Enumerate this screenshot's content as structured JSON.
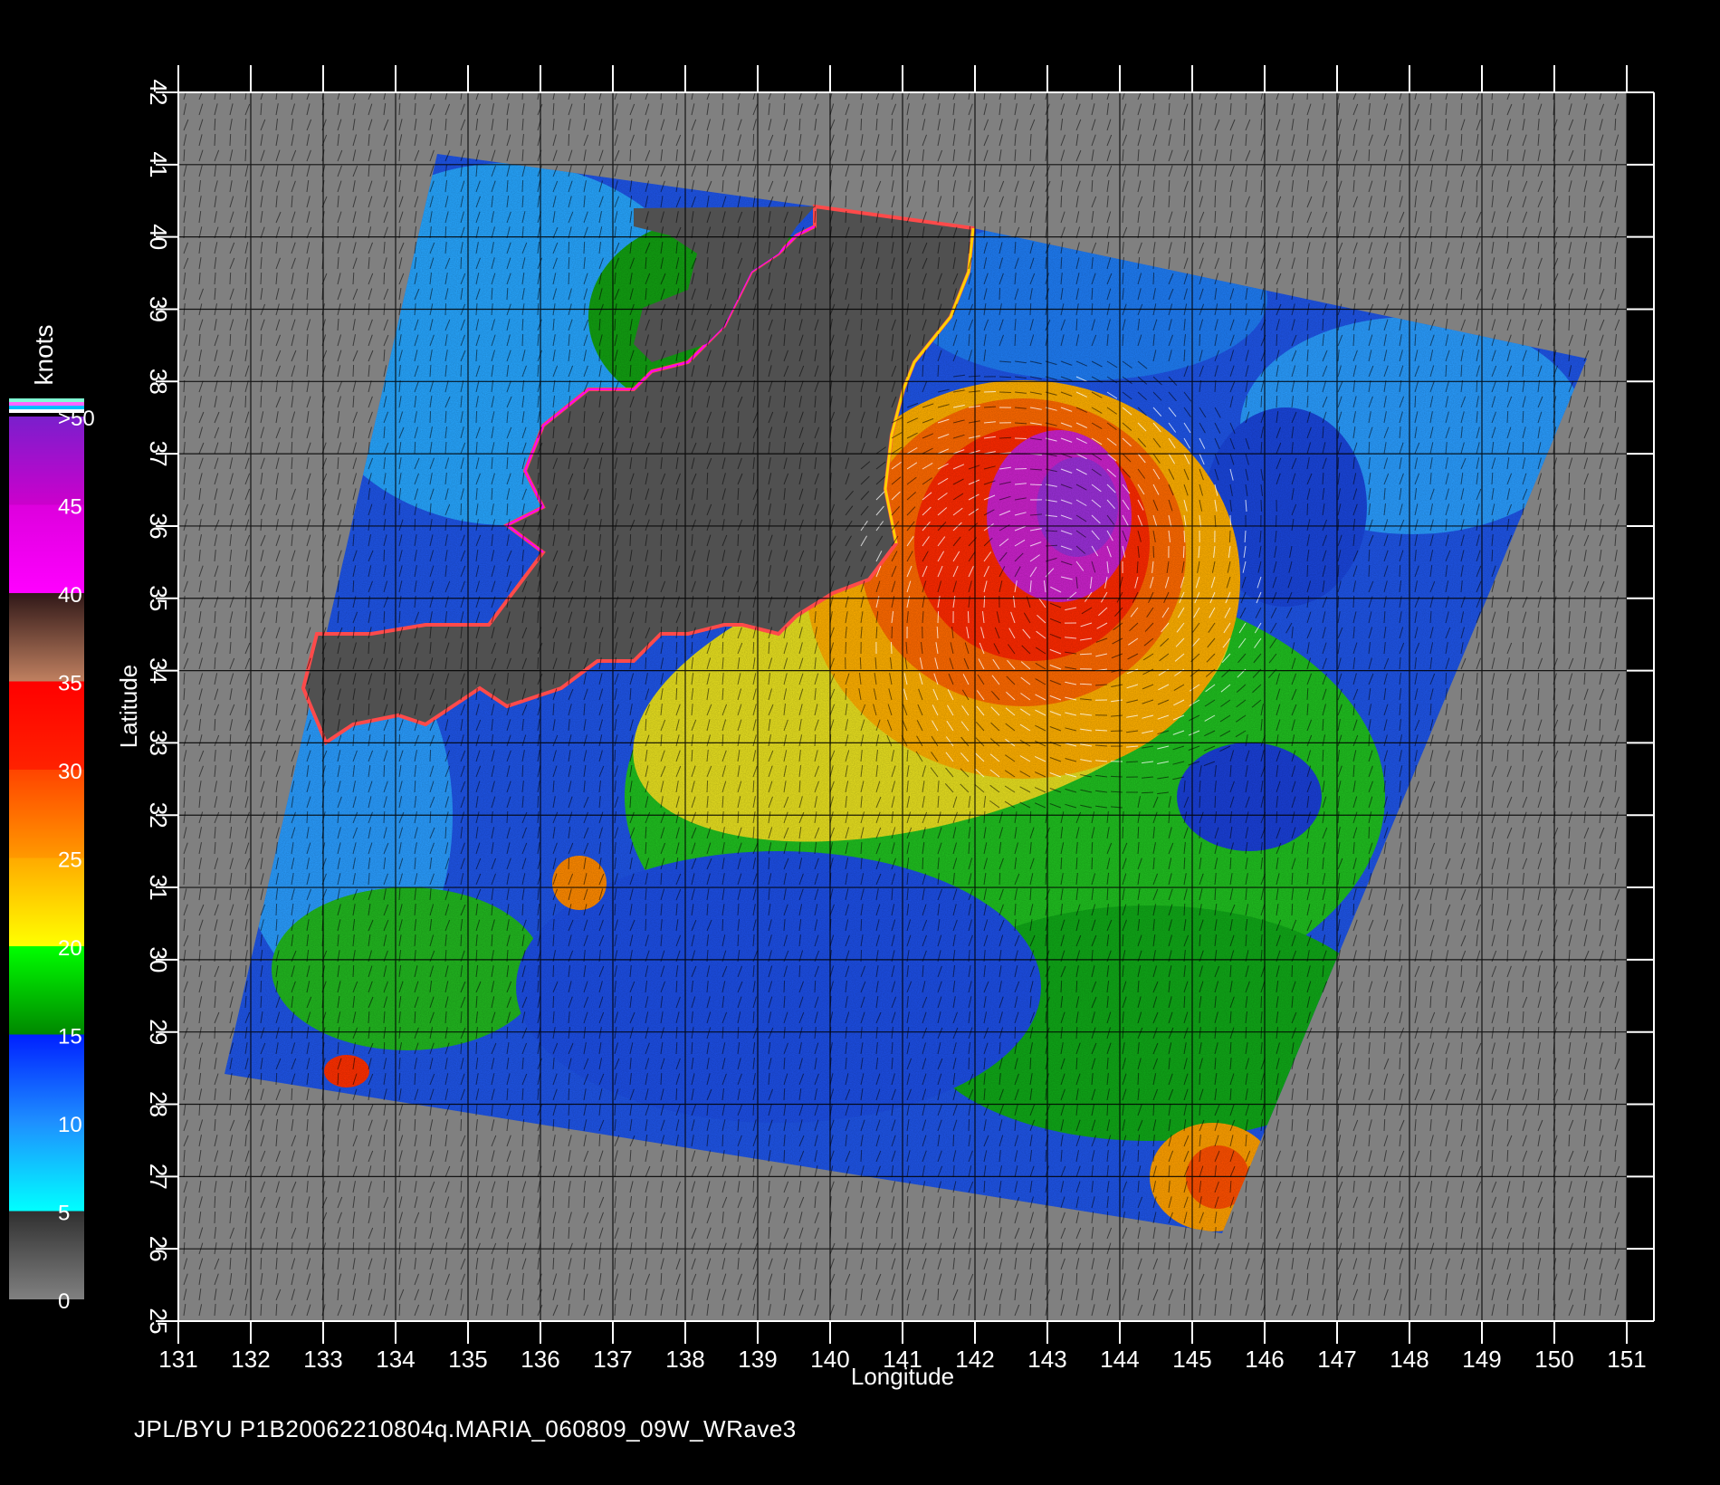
{
  "map": {
    "xlabel": "Longitude",
    "ylabel": "Latitude",
    "lon_range": [
      131,
      151
    ],
    "lat_range": [
      25,
      42
    ],
    "lon_ticks": [
      "131",
      "132",
      "133",
      "134",
      "135",
      "136",
      "137",
      "138",
      "139",
      "140",
      "141",
      "142",
      "143",
      "144",
      "145",
      "146",
      "147",
      "148",
      "149",
      "150",
      "151"
    ],
    "lat_ticks": [
      "25",
      "26",
      "27",
      "28",
      "29",
      "30",
      "31",
      "32",
      "33",
      "34",
      "35",
      "36",
      "37",
      "38",
      "39",
      "40",
      "41",
      "42"
    ],
    "gridlines": true,
    "storm_center": {
      "lon": 143.2,
      "lat": 35.2
    },
    "background_color": "#000000",
    "nodata_color": "#808080",
    "land_color": "#505050"
  },
  "colorbar": {
    "unit_label": "knots",
    "labels": [
      ">50",
      "45",
      "40",
      "35",
      "30",
      "25",
      "20",
      "15",
      "10",
      "5",
      "0"
    ],
    "bands": [
      {
        "from": 0,
        "to": 5,
        "colors": [
          "#808080",
          "#303030"
        ]
      },
      {
        "from": 5,
        "to": 10,
        "colors": [
          "#00ffff",
          "#1e90ff"
        ]
      },
      {
        "from": 10,
        "to": 15,
        "colors": [
          "#1e90ff",
          "#0020ff"
        ]
      },
      {
        "from": 15,
        "to": 20,
        "colors": [
          "#008800",
          "#00ff00"
        ]
      },
      {
        "from": 20,
        "to": 25,
        "colors": [
          "#ffff00",
          "#ffaa00"
        ]
      },
      {
        "from": 25,
        "to": 30,
        "colors": [
          "#ff9900",
          "#ff4400"
        ]
      },
      {
        "from": 30,
        "to": 35,
        "colors": [
          "#ff2200",
          "#ff0000"
        ]
      },
      {
        "from": 35,
        "to": 40,
        "colors": [
          "#c08060",
          "#301818"
        ]
      },
      {
        "from": 40,
        "to": 45,
        "colors": [
          "#ff00ff",
          "#dd00dd"
        ]
      },
      {
        "from": 45,
        "to": 50,
        "colors": [
          "#cc00cc",
          "#7a1fcc"
        ]
      }
    ],
    "cap_colors": [
      "#7fffd4",
      "#ff66ff",
      "#00bfff",
      "#ffffff"
    ]
  },
  "footer": {
    "text": "JPL/BYU  P1B20062210804q.MARIA_060809_09W_WRave3"
  }
}
